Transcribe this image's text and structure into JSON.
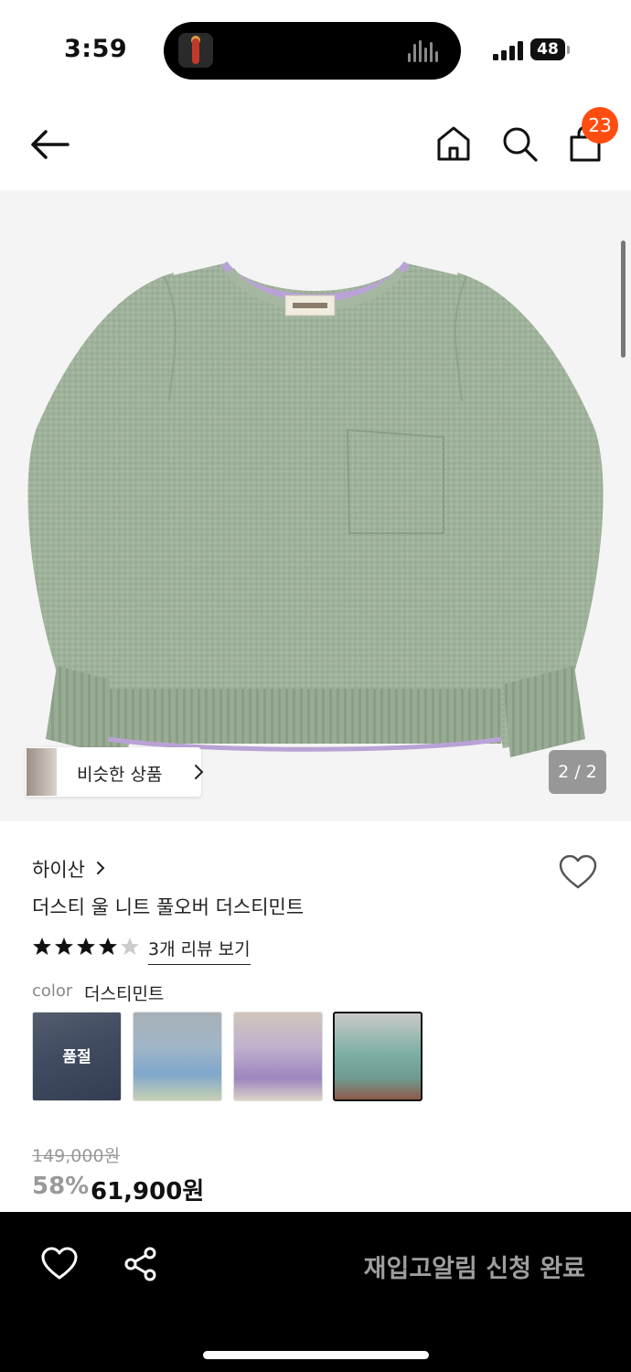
{
  "status_bar": {
    "time": "3:59",
    "battery": "48"
  },
  "nav": {
    "cart_count": "23",
    "back_icon": "arrow-left-icon",
    "home_icon": "home-icon",
    "search_icon": "search-icon",
    "bag_icon": "shopping-bag-icon"
  },
  "gallery": {
    "similar_label": "비슷한 상품",
    "page_indicator": "2 / 2"
  },
  "product": {
    "brand": "하이산",
    "name": "더스티 울 니트 풀오버 더스티민트",
    "rating": 4.5,
    "review_link": "3개 리뷰 보기",
    "color_label": "color",
    "color_value": "더스티민트",
    "swatches": [
      {
        "soldout_label": "품절",
        "selected": false
      },
      {
        "selected": false
      },
      {
        "selected": false
      },
      {
        "selected": true
      }
    ],
    "original_price": "149,000원",
    "discount_rate": "58%",
    "sale_price": "61,900원"
  },
  "bottom_bar": {
    "restock_label": "재입고알림 신청 완료",
    "heart_icon": "heart-icon",
    "share_icon": "share-icon"
  },
  "colors": {
    "accent_badge": "#ff4d12",
    "sweater_green": "#9fb19a",
    "trim_lilac": "#b9a2d6",
    "bottom_bar": "#000000"
  }
}
